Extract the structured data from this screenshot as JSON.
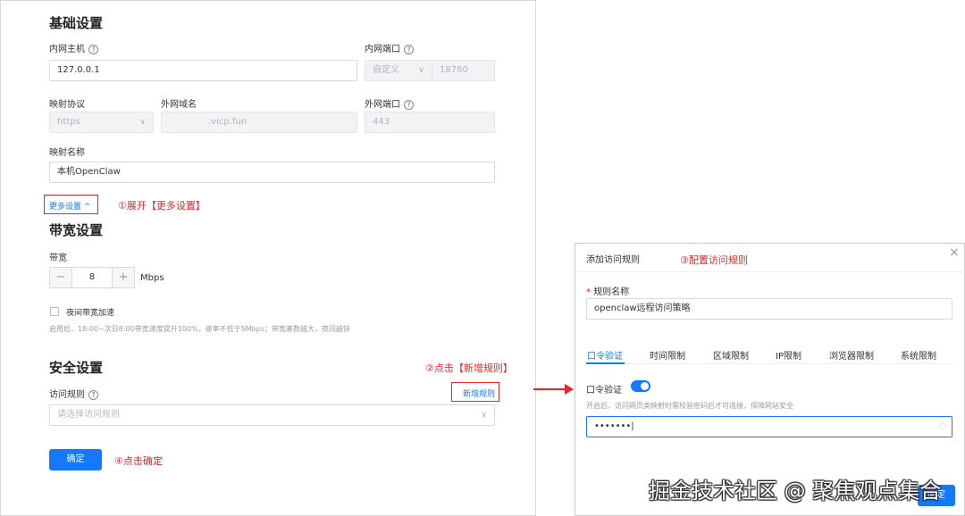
{
  "basic": {
    "title": "基础设置",
    "internal_host_label": "内网主机",
    "internal_host_value": "127.0.0.1",
    "internal_port_label": "内网端口",
    "internal_port_mode": "自定义",
    "internal_port_value": "18780",
    "protocol_label": "映射协议",
    "protocol_value": "https",
    "domain_label": "外网域名",
    "domain_value": ".vicp.fun",
    "external_port_label": "外网端口",
    "external_port_value": "443",
    "name_label": "映射名称",
    "name_value": "本机OpenClaw",
    "more_settings": "更多设置 ^"
  },
  "bandwidth": {
    "title": "带宽设置",
    "label": "带宽",
    "minus": "−",
    "value": "8",
    "plus": "+",
    "unit": "Mbps",
    "night_boost_label": "夜间带宽加速",
    "night_boost_desc": "启用后，18:00~次日8:00带宽速度提升100%，速率不低于5Mbps；带宽基数越大，夜间越快"
  },
  "security": {
    "title": "安全设置",
    "access_rule_label": "访问规则",
    "add_rule_link": "新增规则",
    "select_placeholder": "请选择访问规则",
    "confirm_button": "确定"
  },
  "notes": {
    "step1": "①展开【更多设置】",
    "step2": "②点击【新增规则】",
    "step3": "③配置访问规则",
    "step4": "④点击确定"
  },
  "dialog": {
    "title": "添加访问规则",
    "close": "×",
    "rule_name_label": "规则名称",
    "required_mark": "*",
    "rule_name_value": "openclaw远程访问策略",
    "tabs": [
      {
        "label": "口令验证"
      },
      {
        "label": "时间限制"
      },
      {
        "label": "区域限制"
      },
      {
        "label": "IP限制"
      },
      {
        "label": "浏览器限制"
      },
      {
        "label": "系统限制"
      }
    ],
    "password_toggle_label": "口令验证",
    "password_desc": "开启后，访问网页类映射时需校验密码后才可连接，保障网站安全",
    "password_value": "•••••••|",
    "confirm_button": "确定"
  },
  "watermark": "掘金技术社区 @ 聚焦观点集合",
  "colors": {
    "primary": "#1677ff",
    "annotation": "#e5262a"
  }
}
